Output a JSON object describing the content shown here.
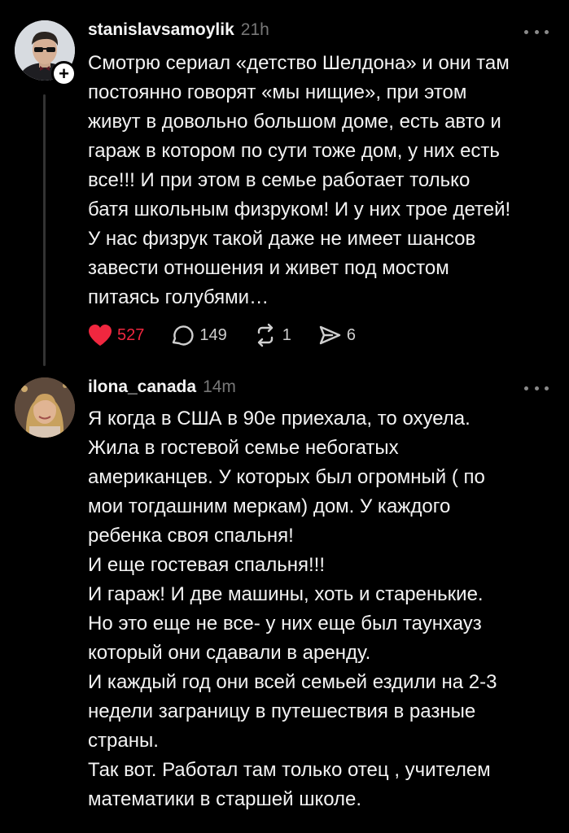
{
  "posts": [
    {
      "username": "stanislavsamoylik",
      "time": "21h",
      "text": "Смотрю сериал «детство Шелдона» и они там\nпостоянно говорят «мы нищие», при этом\nживут в довольно большом доме, есть авто и\nгараж в котором по сути тоже дом, у них есть\nвсе!!! И при этом в семье работает только\nбатя школьным физруком! И у них трое детей!\nУ нас физрук такой даже не имеет шансов\nзавести отношения и живет под мостом\nпитаясь голубями…",
      "likes": "527",
      "comments": "149",
      "reposts": "1",
      "shares": "6",
      "liked_color": "#f0273f"
    },
    {
      "username": "ilona_canada",
      "time": "14m",
      "text": "Я когда в США в 90е приехала, то охуела.\nЖила в гостевой семье небогатых\nамериканцев. У которых был огромный ( по\nмои тогдашним меркам) дом. У каждого\nребенка своя спальня!\nИ еще гостевая спальня!!!\nИ гараж! И две машины, хоть и старенькие.\nНо это еще не все- у них еще был таунхауз\nкоторый они сдавали в аренду.\nИ каждый год они всей семьей ездили на 2-3\nнедели заграницу в путешествия в разные\nстраны.\nТак вот. Работал там только отец , учителем\nматематики в старшей школе."
    }
  ],
  "icons": {
    "heart": "heart-icon",
    "comment": "comment-icon",
    "repost": "repost-icon",
    "share": "share-icon",
    "more": "more-icon",
    "follow": "plus-icon"
  }
}
